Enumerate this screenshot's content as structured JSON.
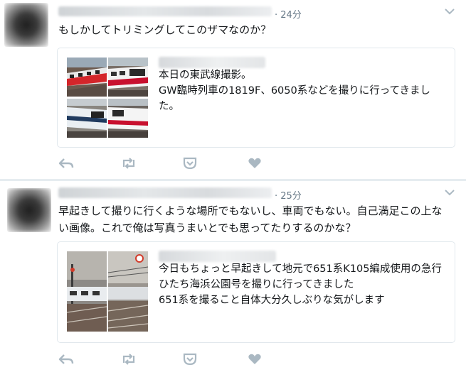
{
  "tweets": [
    {
      "time": "· 24分",
      "text": "もしかしてトリミングしてこのザマなのか？",
      "quote": {
        "text": "本日の東武線撮影。\nGW臨時列車の1819F、6050系などを撮りに行ってきました。"
      },
      "actions": [
        "reply-icon",
        "retweet-icon",
        "pocket-icon",
        "heart-icon"
      ]
    },
    {
      "time": "· 25分",
      "text": "早起きして撮りに行くような場所でもないし、車両でもない。自己満足この上ない画像。これで俺は写真うまいとでも思ってたりするのかな？",
      "quote": {
        "text": "今日もちょっと早起きして地元で651系K105編成使用の急行ひたち海浜公園号を撮りに行ってきました\n651系を撮ること自体大分久しぶりな気がします"
      },
      "actions": [
        "reply-icon",
        "retweet-icon",
        "pocket-icon",
        "heart-icon"
      ]
    }
  ],
  "colors": {
    "icon": "#aab8c2",
    "meta": "#657786",
    "divider": "#e6ecf0",
    "border": "#e1e8ed"
  }
}
